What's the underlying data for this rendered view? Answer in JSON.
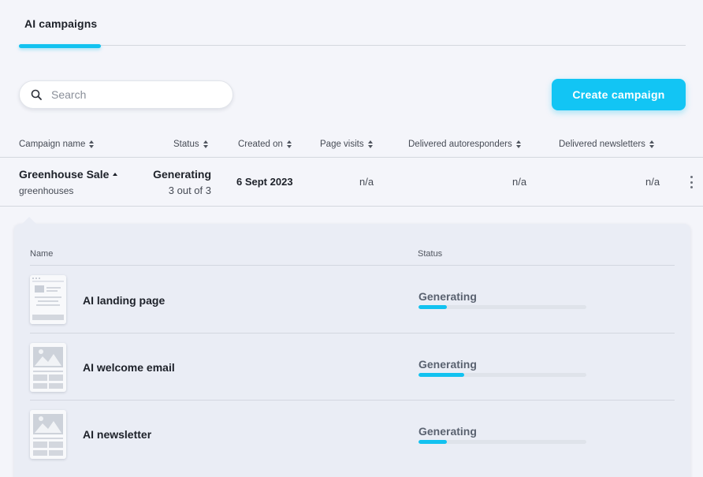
{
  "tabs": [
    {
      "label": "AI campaigns",
      "active": true
    }
  ],
  "search": {
    "placeholder": "Search",
    "value": ""
  },
  "create_button": {
    "label": "Create campaign"
  },
  "columns": [
    {
      "label": "Campaign name"
    },
    {
      "label": "Status"
    },
    {
      "label": "Created on"
    },
    {
      "label": "Page visits"
    },
    {
      "label": "Delivered autoresponders"
    },
    {
      "label": "Delivered newsletters"
    }
  ],
  "campaign": {
    "name": "Greenhouse Sale",
    "subtitle": "greenhouses",
    "status": "Generating",
    "progress": "3 out of 3",
    "created_on": "6 Sept 2023",
    "page_visits": "n/a",
    "delivered_autoresponders": "n/a",
    "delivered_newsletters": "n/a"
  },
  "details": {
    "columns": [
      {
        "label": "Name"
      },
      {
        "label": "Status"
      }
    ],
    "assets": [
      {
        "name": "AI landing page",
        "status": "Generating",
        "progress_pct": 17,
        "icon": "landing-page-thumbnail"
      },
      {
        "name": "AI welcome email",
        "status": "Generating",
        "progress_pct": 27,
        "icon": "email-thumbnail"
      },
      {
        "name": "AI newsletter",
        "status": "Generating",
        "progress_pct": 17,
        "icon": "newsletter-thumbnail"
      }
    ]
  },
  "colors": {
    "accent": "#12c2f0",
    "background": "#f4f5fa",
    "panel": "#eaedf5"
  }
}
